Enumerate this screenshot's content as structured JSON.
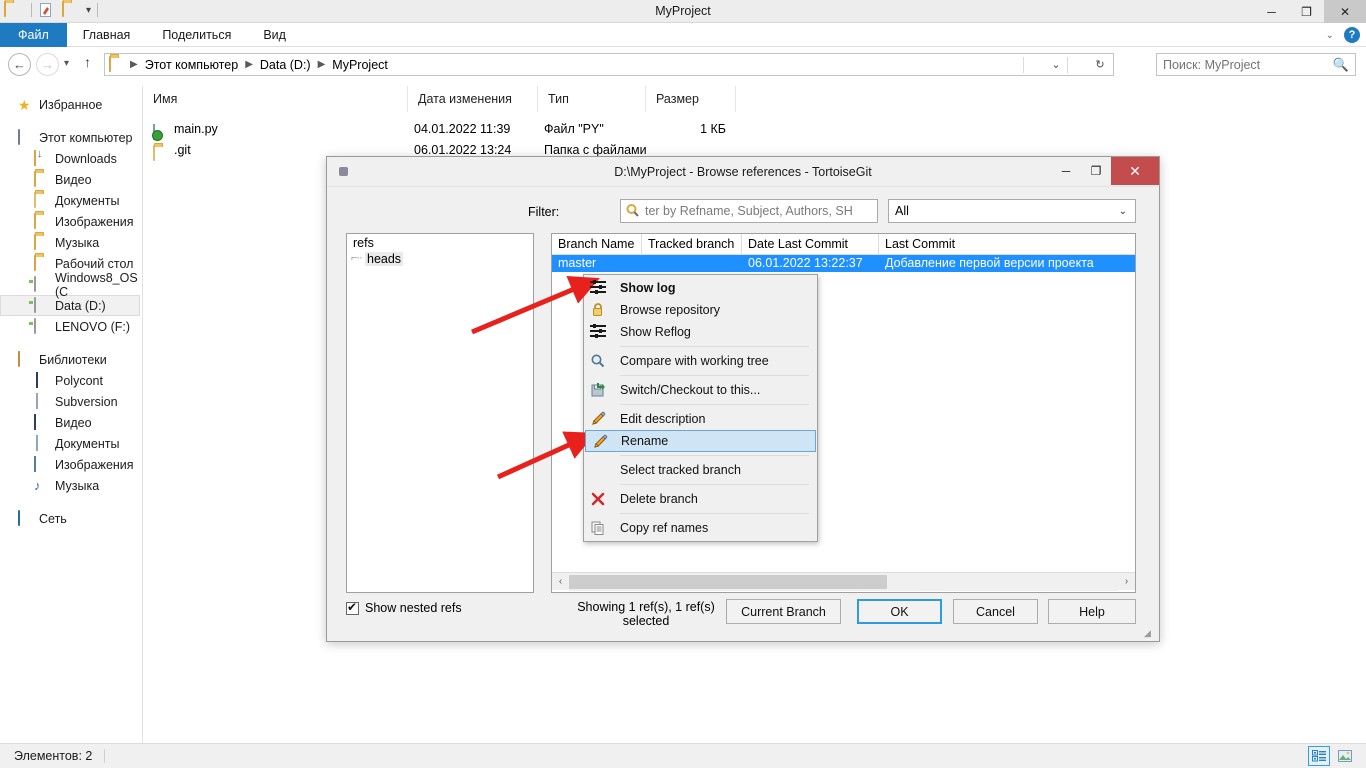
{
  "explorer": {
    "window_title": "MyProject",
    "quick_access": [
      "folder-icon",
      "properties-icon",
      "new-folder-icon",
      "customize-caret"
    ],
    "window_buttons": {
      "minimize": "─",
      "maximize": "❐",
      "close": "✕"
    },
    "ribbon_tabs": [
      {
        "label": "Файл",
        "active": true
      },
      {
        "label": "Главная",
        "active": false
      },
      {
        "label": "Поделиться",
        "active": false
      },
      {
        "label": "Вид",
        "active": false
      }
    ],
    "ribbon_right": {
      "collapse": "⌄",
      "help": "?"
    },
    "address": {
      "back": "←",
      "forward": "→",
      "recent": "▾",
      "up": "↑",
      "crumbs": [
        "Этот компьютер",
        "Data (D:)",
        "MyProject"
      ],
      "dropdown": "⌄",
      "refresh": "↻"
    },
    "search": {
      "placeholder": "Поиск: MyProject",
      "icon": "search-icon"
    },
    "nav_pane": {
      "groups": [
        {
          "label": "Избранное",
          "icon": "star-icon",
          "root": true,
          "items": []
        },
        {
          "label": "Этот компьютер",
          "icon": "computer-icon",
          "root": true,
          "items": [
            {
              "label": "Downloads",
              "icon": "downloads-folder-icon"
            },
            {
              "label": "Видео",
              "icon": "video-folder-icon"
            },
            {
              "label": "Документы",
              "icon": "documents-folder-icon"
            },
            {
              "label": "Изображения",
              "icon": "pictures-folder-icon"
            },
            {
              "label": "Музыка",
              "icon": "music-folder-icon"
            },
            {
              "label": "Рабочий стол",
              "icon": "desktop-folder-icon"
            },
            {
              "label": "Windows8_OS (C",
              "icon": "drive-icon"
            },
            {
              "label": "Data (D:)",
              "icon": "drive-icon",
              "selected": true
            },
            {
              "label": "LENOVO (F:)",
              "icon": "drive-icon"
            }
          ]
        },
        {
          "label": "Библиотеки",
          "icon": "library-icon",
          "root": true,
          "items": [
            {
              "label": "Polycont",
              "icon": "library-item-icon"
            },
            {
              "label": "Subversion",
              "icon": "library-item-icon"
            },
            {
              "label": "Видео",
              "icon": "video-library-icon"
            },
            {
              "label": "Документы",
              "icon": "documents-library-icon"
            },
            {
              "label": "Изображения",
              "icon": "pictures-library-icon"
            },
            {
              "label": "Музыка",
              "icon": "music-library-icon"
            }
          ]
        },
        {
          "label": "Сеть",
          "icon": "network-icon",
          "root": true,
          "items": []
        }
      ]
    },
    "file_list": {
      "columns": [
        "Имя",
        "Дата изменения",
        "Тип",
        "Размер"
      ],
      "sorted_column": "Имя",
      "rows": [
        {
          "name": "main.py",
          "icon": "python-file-icon",
          "modified": "04.01.2022 11:39",
          "type": "Файл \"PY\"",
          "size": "1 КБ"
        },
        {
          "name": ".git",
          "icon": "folder-icon",
          "modified": "06.01.2022 13:24",
          "type": "Папка с файлами",
          "size": ""
        }
      ]
    },
    "status_bar": {
      "text": "Элементов: 2",
      "view_details_icon": "details-view-icon",
      "view_thumbs_icon": "thumbnails-view-icon"
    }
  },
  "dialog": {
    "title": "D:\\MyProject - Browse references - TortoiseGit",
    "icon": "tortoisegit-icon",
    "window_buttons": {
      "minimize": "─",
      "maximize": "❐",
      "close": "✕"
    },
    "filter": {
      "label": "Filter:",
      "input_value": "ter by Refname, Subject, Authors, SH",
      "icon": "search-icon",
      "scope_selected": "All",
      "scope_arrow": "⌄"
    },
    "refs_tree": {
      "root": "refs",
      "child": "heads"
    },
    "branch_list": {
      "columns": [
        "Branch Name",
        "Tracked branch",
        "Date Last Commit",
        "Last Commit"
      ],
      "sorted_column": "Branch Name",
      "rows": [
        {
          "branch_name": "master",
          "tracked_branch": "",
          "date_last_commit": "06.01.2022 13:22:37",
          "last_commit": "Добавление первой версии проекта",
          "selected": true
        }
      ]
    },
    "hscroll": {
      "left_arrow": "‹",
      "right_arrow": "›"
    },
    "show_nested_refs": {
      "label": "Show nested refs",
      "checked": true
    },
    "showing_text": "Showing 1 ref(s), 1 ref(s) selected",
    "buttons": [
      {
        "label": "Current Branch",
        "primary": false
      },
      {
        "label": "OK",
        "primary": true
      },
      {
        "label": "Cancel",
        "primary": false
      },
      {
        "label": "Help",
        "primary": false
      }
    ]
  },
  "context_menu": {
    "items": [
      {
        "label": "Show log",
        "icon": "log-icon",
        "bold": true,
        "separator_after": false
      },
      {
        "label": "Browse repository",
        "icon": "lock-icon",
        "bold": false,
        "separator_after": false
      },
      {
        "label": "Show Reflog",
        "icon": "log-icon",
        "bold": false,
        "separator_after": true
      },
      {
        "label": "Compare with working tree",
        "icon": "magnifier-icon",
        "bold": false,
        "separator_after": true
      },
      {
        "label": "Switch/Checkout to this...",
        "icon": "switch-icon",
        "bold": false,
        "separator_after": true
      },
      {
        "label": "Edit description",
        "icon": "pencil-icon",
        "bold": false,
        "separator_after": false
      },
      {
        "label": "Rename",
        "icon": "pencil-icon",
        "bold": false,
        "highlighted": true,
        "separator_after": true
      },
      {
        "label": "Select tracked branch",
        "icon": "none",
        "bold": false,
        "separator_after": true
      },
      {
        "label": "Delete branch",
        "icon": "delete-x-icon",
        "bold": false,
        "separator_after": true
      },
      {
        "label": "Copy ref names",
        "icon": "copy-icon",
        "bold": false,
        "separator_after": false
      }
    ]
  },
  "annotations": {
    "arrow_color": "#e8211c",
    "arrows": [
      {
        "name": "arrow-to-selected-branch"
      },
      {
        "name": "arrow-to-rename-item"
      }
    ]
  },
  "colors": {
    "accent_blue": "#1f7bc1",
    "selection_blue": "#1e90ff",
    "close_red": "#c34d4d",
    "arrow_red": "#e8211c"
  }
}
